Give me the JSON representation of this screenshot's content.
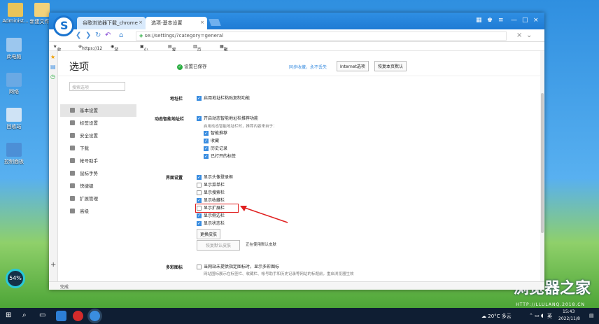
{
  "desktop": {
    "icons": [
      {
        "label": "Administ..."
      },
      {
        "label": "新建文件夹"
      },
      {
        "label": "此电脑"
      },
      {
        "label": "网络"
      },
      {
        "label": "回收站"
      },
      {
        "label": "控制面板"
      }
    ],
    "gauge_value": "54%",
    "watermark": "浏览器之家",
    "watermark_url": "HTTP://LLULANQ.2018.CN"
  },
  "browser": {
    "tabs": [
      {
        "label": "谷歌浏览器下载_chrome"
      },
      {
        "label": "选项-基本设置"
      }
    ],
    "address": "se://settings/?category=general",
    "bookmarks": [
      "收藏",
      "https://12",
      "游戏中心",
      "小说大全",
      "爱淘宝",
      "京东商城",
      "聚划算"
    ],
    "status_text": "完成"
  },
  "settings": {
    "title": "选项",
    "saved_text": "设置已保存",
    "sync_text": "同步收藏，永不丢失",
    "ie_button": "Internet选项",
    "restore_button": "恢复本页默认",
    "search_placeholder": "搜索选项",
    "menu": [
      {
        "label": "基本设置",
        "icon": "gear-icon"
      },
      {
        "label": "标签设置",
        "icon": "tab-icon"
      },
      {
        "label": "安全设置",
        "icon": "shield-icon"
      },
      {
        "label": "下载",
        "icon": "download-icon"
      },
      {
        "label": "帐号助手",
        "icon": "key-icon"
      },
      {
        "label": "鼠标手势",
        "icon": "mouse-icon"
      },
      {
        "label": "快捷键",
        "icon": "keyboard-icon"
      },
      {
        "label": "扩展管理",
        "icon": "puzzle-icon"
      },
      {
        "label": "高级",
        "icon": "more-icon"
      }
    ],
    "address_bar": {
      "label": "地址栏",
      "option": "启用地址栏粘贴复制功能"
    },
    "smart_bar": {
      "label": "动态智能地址栏",
      "option": "开启动态智能地址栏推荐功能",
      "hint": "启用动态智能地址栏时，推荐内容来自于：",
      "sub": [
        "智能推荐",
        "收藏",
        "历史记录",
        "已打开的标签"
      ]
    },
    "ui": {
      "label": "界面设置",
      "options": [
        {
          "label": "显示头像登录框",
          "checked": true
        },
        {
          "label": "显示菜单栏",
          "checked": false
        },
        {
          "label": "显示搜索栏",
          "checked": false
        },
        {
          "label": "显示收藏栏",
          "checked": true
        },
        {
          "label": "显示扩展栏",
          "checked": false
        },
        {
          "label": "显示侧边栏",
          "checked": true
        },
        {
          "label": "显示状态栏",
          "checked": true
        }
      ],
      "skin_button": "更换皮肤",
      "restore_skin_button": "恢复默认皮肤",
      "skin_status": "正在使用默认皮肤"
    },
    "icons": {
      "label": "多彩图标",
      "option": "当网站未提供指定图标时，显示多彩图标",
      "hint": "网站图标展示在标签栏、收藏栏、帐号助手和历史记录等网站的标题前，重启浏览器生效"
    }
  },
  "taskbar": {
    "weather": "20°C 多云",
    "lang": "英",
    "time": "15:43",
    "date": "2022/11/8"
  },
  "colors": {
    "accent": "#3a8de0",
    "highlight": "#e02020"
  }
}
